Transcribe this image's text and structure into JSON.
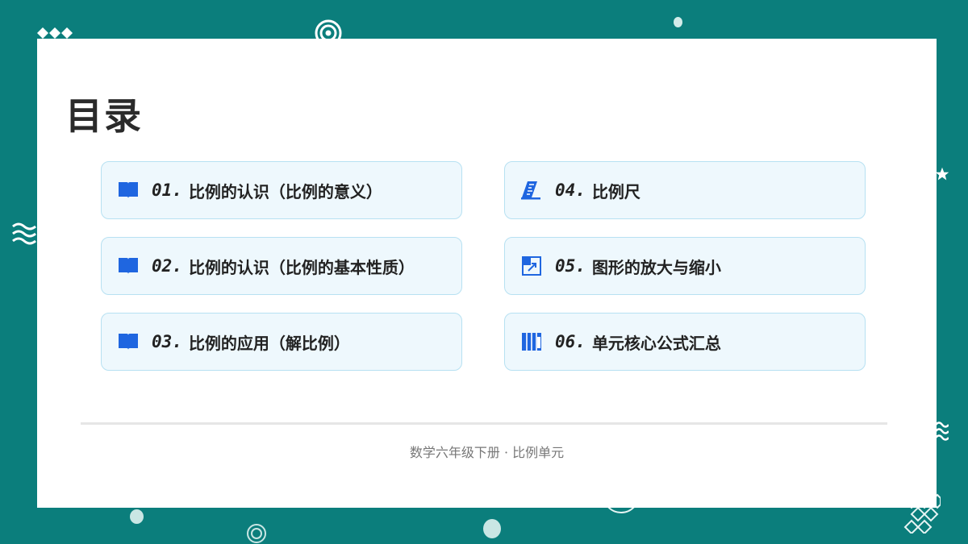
{
  "slide": {
    "title": "目录",
    "footer": "数学六年级下册 · 比例单元"
  },
  "items": [
    {
      "num": "01.",
      "label": "比例的认识（比例的意义）",
      "icon": "book-icon"
    },
    {
      "num": "02.",
      "label": "比例的认识（比例的基本性质）",
      "icon": "book-icon"
    },
    {
      "num": "03.",
      "label": "比例的应用（解比例）",
      "icon": "book-icon"
    },
    {
      "num": "04.",
      "label": "比例尺",
      "icon": "ruler-icon"
    },
    {
      "num": "05.",
      "label": "图形的放大与缩小",
      "icon": "enlarge-icon"
    },
    {
      "num": "06.",
      "label": "单元核心公式汇总",
      "icon": "formula-icon"
    }
  ],
  "colors": {
    "background": "#0b7e7c",
    "card_fill": "#eef8fd",
    "card_border": "#b7e1f2",
    "icon_blue": "#1f66e0"
  }
}
